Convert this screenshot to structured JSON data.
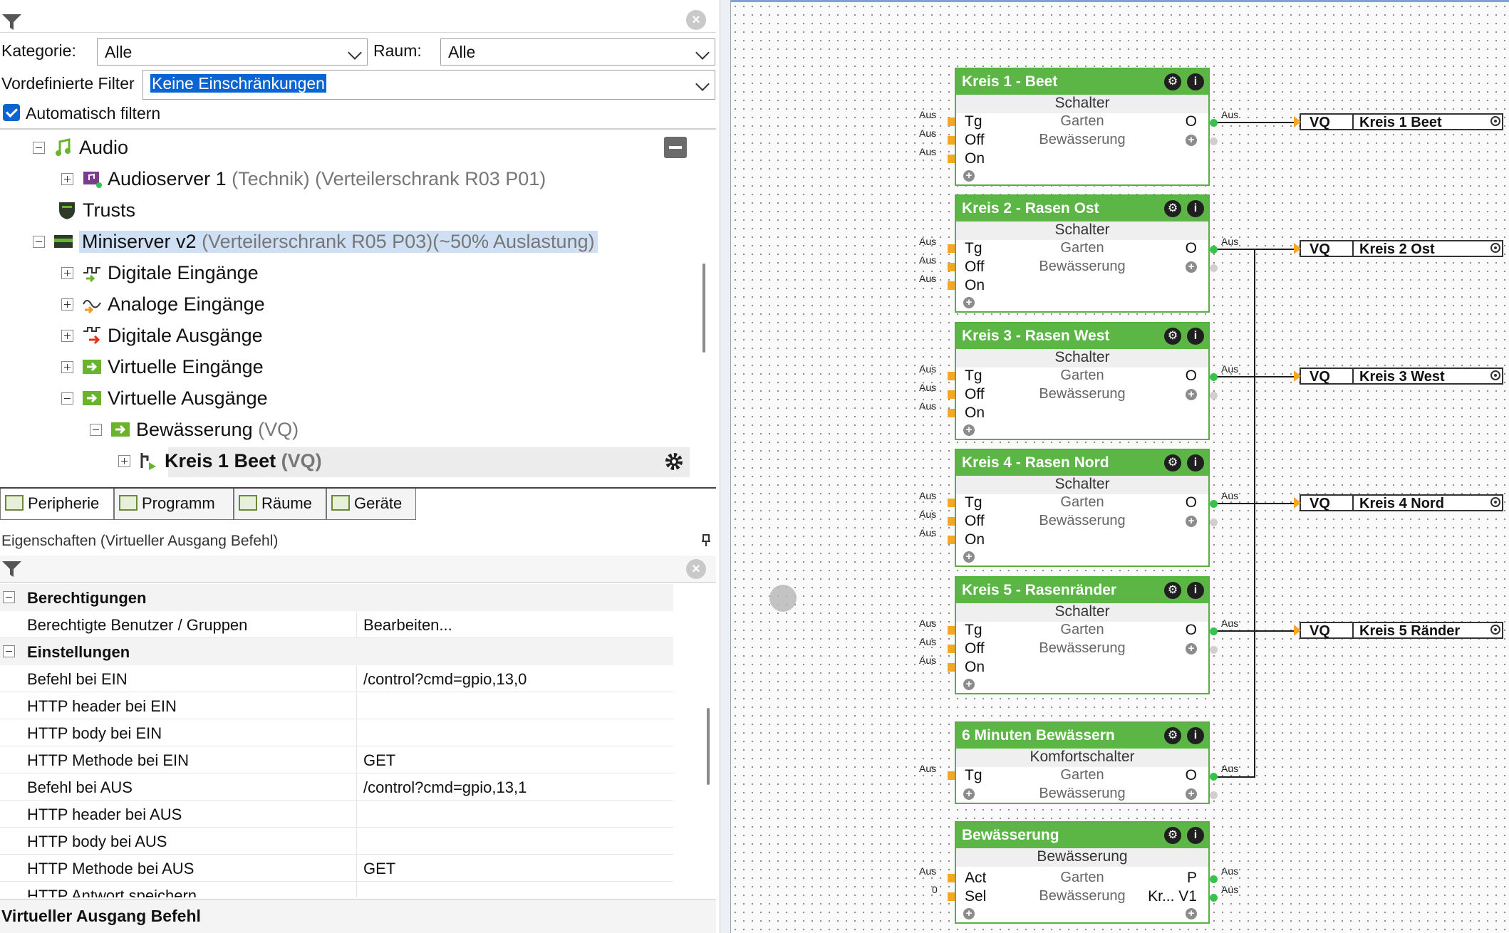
{
  "filter": {
    "kategorie_label": "Kategorie:",
    "kategorie_value": "Alle",
    "raum_label": "Raum:",
    "raum_value": "Alle",
    "vordefiniert_label": "Vordefinierte Filter",
    "vordefiniert_value": "Keine Einschränkungen",
    "auto_filter_label": "Automatisch filtern"
  },
  "tree": {
    "audio": "Audio",
    "audioserver": "Audioserver 1",
    "audioserver_meta": "(Technik) (Verteilerschrank R03 P01)",
    "trusts": "Trusts",
    "miniserver": "Miniserver v2",
    "miniserver_meta": "(Verteilerschrank R05 P03)(~50% Auslastung)",
    "di": "Digitale Eingänge",
    "ai": "Analoge Eingänge",
    "do": "Digitale Ausgänge",
    "vi": "Virtuelle Eingänge",
    "vo": "Virtuelle Ausgänge",
    "bew": "Bewässerung",
    "bew_meta": "(VQ)",
    "kreis1": "Kreis 1 Beet",
    "kreis1_meta": "(VQ)"
  },
  "tabs": {
    "peripherie": "Peripherie",
    "programm": "Programm",
    "raeume": "Räume",
    "geraete": "Geräte"
  },
  "properties": {
    "title": "Eigenschaften (Virtueller Ausgang Befehl)",
    "cat_berechtigungen": "Berechtigungen",
    "berechtigte_name": "Berechtigte Benutzer / Gruppen",
    "berechtigte_value": "Bearbeiten...",
    "cat_einstellungen": "Einstellungen",
    "befehl_ein_name": "Befehl bei EIN",
    "befehl_ein_value": "/control?cmd=gpio,13,0",
    "header_ein_name": "HTTP header bei EIN",
    "body_ein_name": "HTTP body bei EIN",
    "methode_ein_name": "HTTP Methode bei EIN",
    "methode_ein_value": "GET",
    "befehl_aus_name": "Befehl bei AUS",
    "befehl_aus_value": "/control?cmd=gpio,13,1",
    "header_aus_name": "HTTP header bei AUS",
    "body_aus_name": "HTTP body bei AUS",
    "methode_aus_name": "HTTP Methode bei AUS",
    "methode_aus_value": "GET",
    "truncated_name": "HTTP Antwort speichern"
  },
  "status": "Virtueller Ausgang Befehl",
  "canvas": {
    "aus": "Aus",
    "zero": "0",
    "schalter": "Schalter",
    "garten": "Garten",
    "bewaesserung": "Bewässerung",
    "tg": "Tg",
    "off": "Off",
    "on": "On",
    "o": "O",
    "blocks": [
      {
        "title": "Kreis 1 - Beet"
      },
      {
        "title": "Kreis 2 - Rasen Ost"
      },
      {
        "title": "Kreis 3 - Rasen West"
      },
      {
        "title": "Kreis 4 - Rasen Nord"
      },
      {
        "title": "Kreis 5 - Rasenränder"
      }
    ],
    "komfort_title": "6 Minuten Bewässern",
    "komfort_type": "Komfortschalter",
    "bew_title": "Bewässerung",
    "bew_type": "Bewässerung",
    "act": "Act",
    "sel": "Sel",
    "p": "P",
    "krv1": "Kr... V1",
    "vq_label": "VQ",
    "vq": [
      {
        "name": "Kreis 1 Beet"
      },
      {
        "name": "Kreis 2 Ost"
      },
      {
        "name": "Kreis 3 West"
      },
      {
        "name": "Kreis 4 Nord"
      },
      {
        "name": "Kreis 5 Ränder"
      }
    ]
  },
  "colors": {
    "accent": "#0a64d2",
    "block_green": "#5cb646",
    "input_port": "#f5a623",
    "output_port": "#37c24a"
  }
}
